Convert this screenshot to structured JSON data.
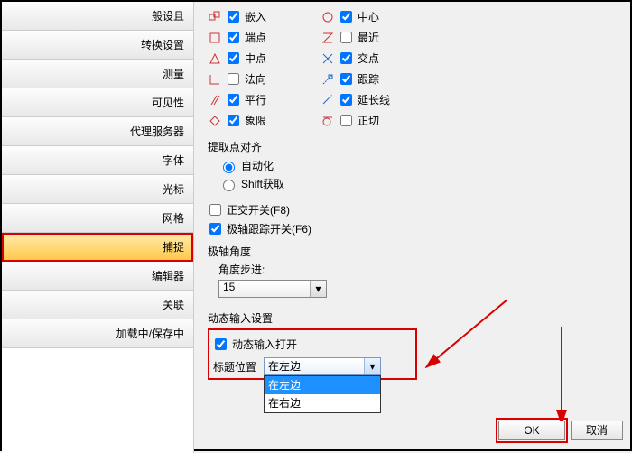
{
  "sidebar": {
    "items": [
      {
        "label": "般设且"
      },
      {
        "label": "转换设置"
      },
      {
        "label": "测量"
      },
      {
        "label": "可见性"
      },
      {
        "label": "代理服务器"
      },
      {
        "label": "字体"
      },
      {
        "label": "光标"
      },
      {
        "label": "网格"
      },
      {
        "label": "捕捉"
      },
      {
        "label": "编辑器"
      },
      {
        "label": "关联"
      },
      {
        "label": "加载中/保存中"
      }
    ],
    "active_index": 8
  },
  "snap": {
    "left": [
      {
        "icon": "insert",
        "label": "嵌入",
        "checked": true
      },
      {
        "icon": "endpoint",
        "label": "端点",
        "checked": true
      },
      {
        "icon": "midpoint",
        "label": "中点",
        "checked": true
      },
      {
        "icon": "normal",
        "label": "法向",
        "checked": false
      },
      {
        "icon": "parallel",
        "label": "平行",
        "checked": true
      },
      {
        "icon": "quadrant",
        "label": "象限",
        "checked": true
      }
    ],
    "right": [
      {
        "icon": "center",
        "label": "中心",
        "checked": true
      },
      {
        "icon": "nearest",
        "label": "最近",
        "checked": false
      },
      {
        "icon": "intersection",
        "label": "交点",
        "checked": true
      },
      {
        "icon": "track",
        "label": "跟踪",
        "checked": true
      },
      {
        "icon": "extension",
        "label": "延长线",
        "checked": true
      },
      {
        "icon": "tangent",
        "label": "正切",
        "checked": false
      }
    ]
  },
  "align": {
    "title": "提取点对齐",
    "auto": "自动化",
    "shift": "Shift获取",
    "selected": "auto"
  },
  "ortho": {
    "label": "正交开关(F8)",
    "checked": false
  },
  "polar_track": {
    "label": "极轴跟踪开关(F6)",
    "checked": true
  },
  "polar_angle": {
    "title": "极轴角度",
    "step_label": "角度步进:",
    "value": "15"
  },
  "dynamic": {
    "title": "动态输入设置",
    "enable": {
      "label": "动态输入打开",
      "checked": true
    },
    "caption_label": "标题位置",
    "caption_value": "在左边",
    "options": [
      "在左边",
      "在右边"
    ]
  },
  "buttons": {
    "ok": "OK",
    "cancel": "取消"
  }
}
